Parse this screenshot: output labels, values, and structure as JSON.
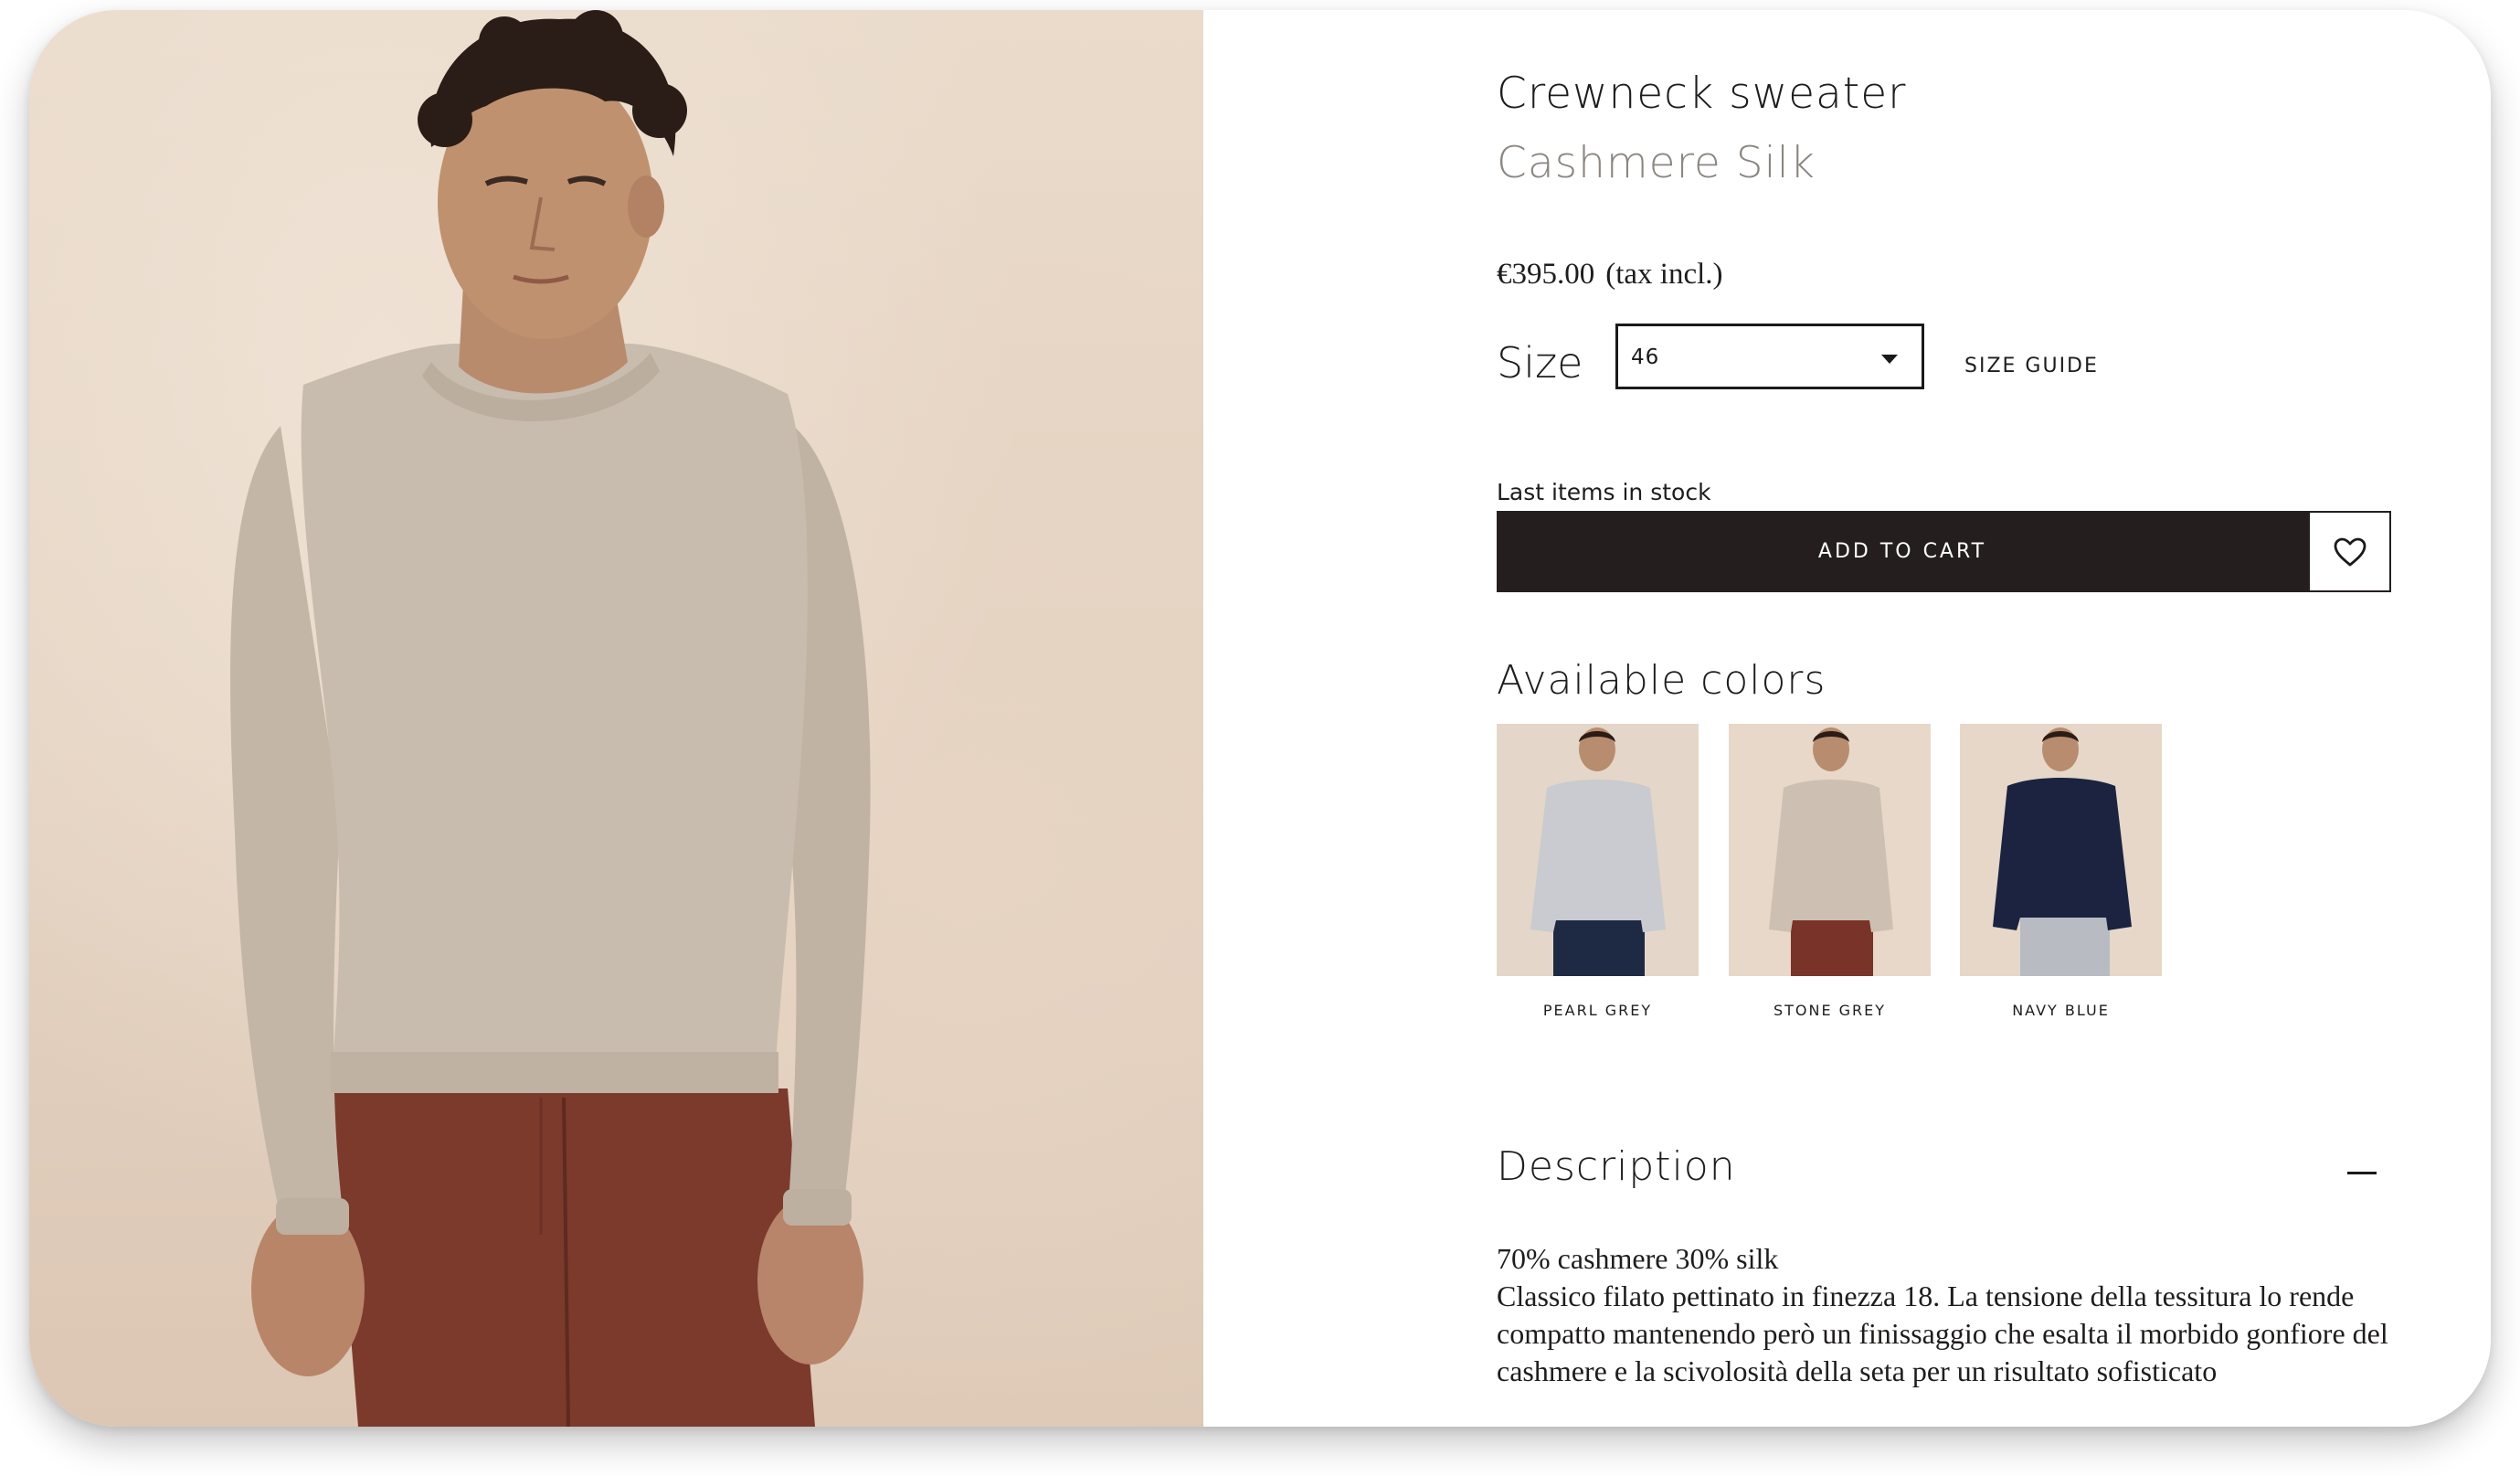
{
  "product": {
    "title": "Crewneck sweater",
    "subtitle": "Cashmere Silk",
    "price": "€395.00",
    "tax_note": "(tax incl.)"
  },
  "size": {
    "label": "Size",
    "selected": "46",
    "guide_label": "SIZE GUIDE"
  },
  "stock_status": "Last items in stock",
  "actions": {
    "add_to_cart": "ADD TO CART",
    "wishlist_icon": "heart-icon"
  },
  "colors": {
    "heading": "Available colors",
    "options": [
      {
        "name": "PEARL GREY",
        "sweater": "#c9cbd0",
        "pants": "#1e2a44"
      },
      {
        "name": "STONE GREY",
        "sweater": "#cdbfb1",
        "pants": "#7a3328"
      },
      {
        "name": "NAVY BLUE",
        "sweater": "#1b2340",
        "pants": "#b8bcc2"
      }
    ]
  },
  "description": {
    "heading": "Description",
    "toggle_icon": "minus-icon",
    "composition": "70% cashmere 30% silk",
    "text": "Classico filato pettinato in finezza 18. La tensione della tessitura lo rende compatto mantenendo però un finissaggio che esalta il morbido gonfiore del cashmere e la scivolosità della seta per un risultato sofisticato"
  },
  "theme": {
    "button_bg": "#241f1e",
    "subtitle_color": "#8b8680",
    "hero_sweater": "#c8bcae",
    "hero_pants": "#7c3a2c"
  }
}
